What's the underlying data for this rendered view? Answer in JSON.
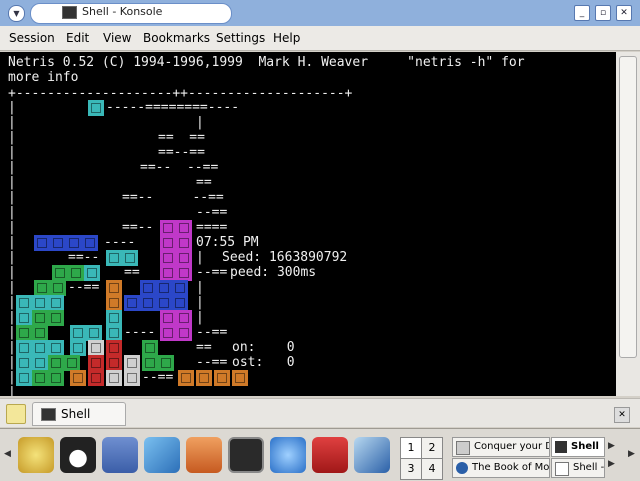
{
  "window": {
    "title": "Shell - Konsole",
    "buttons": {
      "menu": "▼",
      "minimize": "_",
      "maximize": "▫",
      "close": "✕"
    }
  },
  "menubar": [
    "Session",
    "Edit",
    "View",
    "Bookmarks",
    "Settings",
    "Help"
  ],
  "terminal": {
    "header_line1": "Netris 0.52 (C) 1994-1996,1999  Mark H. Weaver     \"netris -h\" for",
    "header_line2": "more info",
    "top_border": "+--------------------++--------------------+",
    "time": "07:55 PM",
    "seed_label": "Seed: 1663890792",
    "speed_label": "peed: 300ms",
    "stat1": "on:    0",
    "stat2": "ost:   0",
    "colors": {
      "cyan": "#3ab8b8",
      "blue": "#2b47c8",
      "green": "#2ea84a",
      "magenta": "#c038c8",
      "orange": "#d07a28",
      "white": "#d0d0d0",
      "red": "#c42a2a",
      "text": "#f0f0f0"
    }
  },
  "tabbar": {
    "tab_label": "Shell"
  },
  "taskbar": {
    "pager": [
      "1",
      "2",
      "3",
      "4"
    ],
    "tasks": [
      {
        "label": "Conquer your D",
        "icon": "window-icon"
      },
      {
        "label": "Shell",
        "icon": "terminal-icon"
      },
      {
        "label": "The Book of Mo",
        "icon": "browser-icon"
      },
      {
        "label": "Shell -",
        "icon": "document-icon"
      }
    ],
    "launchers": [
      "kde-k-menu-icon",
      "tux-penguin-icon",
      "desktop-icon",
      "editor-icon",
      "home-icon",
      "terminal-icon",
      "globe-browser-icon",
      "game-icon",
      "office-icon"
    ]
  }
}
